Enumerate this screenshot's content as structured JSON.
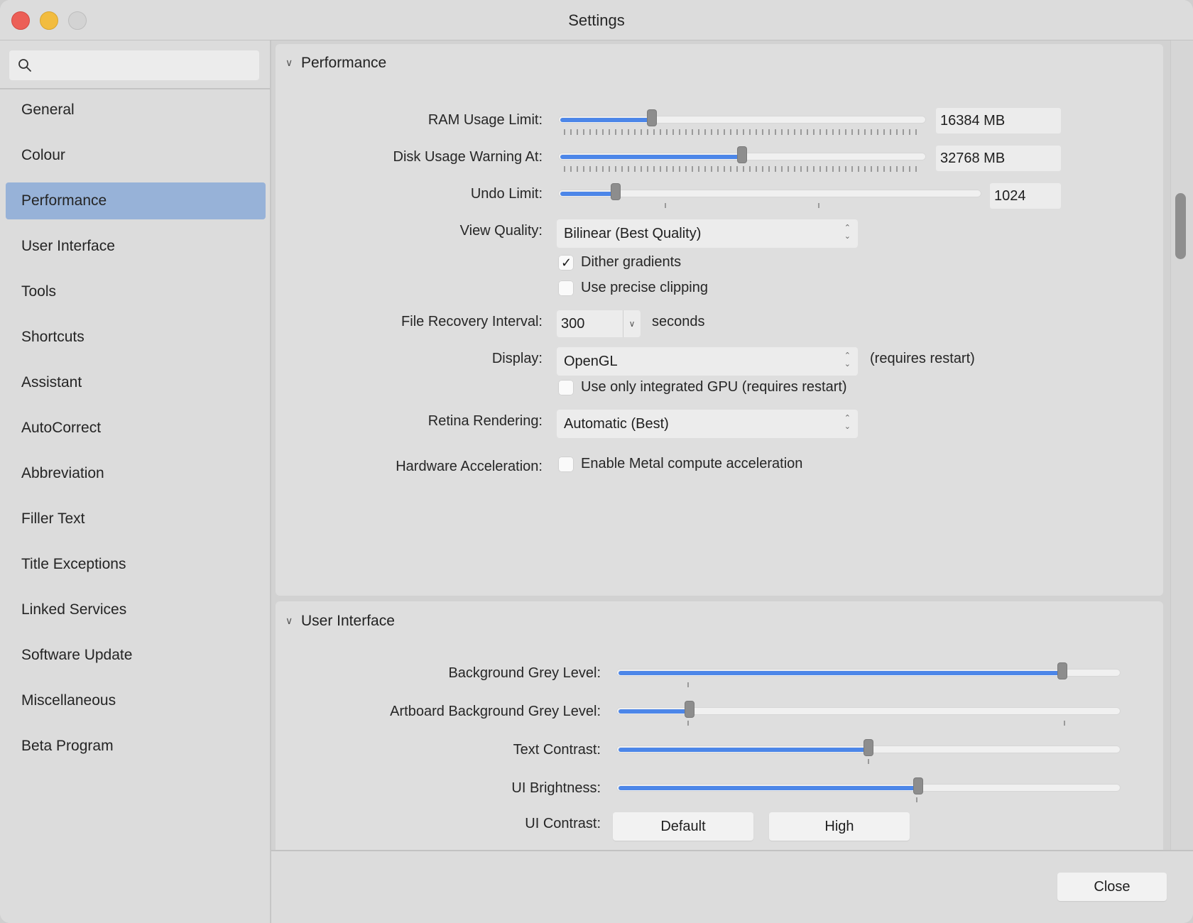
{
  "window": {
    "title": "Settings"
  },
  "search": {
    "placeholder": ""
  },
  "sidebar": {
    "items": [
      {
        "label": "General"
      },
      {
        "label": "Colour"
      },
      {
        "label": "Performance",
        "active": true
      },
      {
        "label": "User Interface"
      },
      {
        "label": "Tools"
      },
      {
        "label": "Shortcuts"
      },
      {
        "label": "Assistant"
      },
      {
        "label": "AutoCorrect"
      },
      {
        "label": "Abbreviation"
      },
      {
        "label": "Filler Text"
      },
      {
        "label": "Title Exceptions"
      },
      {
        "label": "Linked Services"
      },
      {
        "label": "Software Update"
      },
      {
        "label": "Miscellaneous"
      },
      {
        "label": "Beta Program"
      }
    ]
  },
  "performance": {
    "heading": "Performance",
    "ram": {
      "label": "RAM Usage Limit:",
      "value": "16384 MB",
      "level": 0.25
    },
    "disk": {
      "label": "Disk Usage Warning At:",
      "value": "32768 MB",
      "level": 0.5
    },
    "undo": {
      "label": "Undo Limit:",
      "value": "1024",
      "level": 0.13
    },
    "view_quality": {
      "label": "View Quality:",
      "selected": "Bilinear (Best Quality)"
    },
    "dither": {
      "label": "Dither gradients",
      "checked": true
    },
    "precise_clipping": {
      "label": "Use precise clipping",
      "checked": false
    },
    "recovery": {
      "label": "File Recovery Interval:",
      "value": "300",
      "unit": "seconds"
    },
    "display": {
      "label": "Display:",
      "selected": "OpenGL",
      "note": "(requires restart)"
    },
    "integrated_gpu": {
      "label": "Use only integrated GPU (requires restart)",
      "checked": false
    },
    "retina": {
      "label": "Retina Rendering:",
      "selected": "Automatic (Best)"
    },
    "hw_accel": {
      "label": "Hardware Acceleration:",
      "checkbox_label": "Enable Metal compute acceleration",
      "checked": false
    }
  },
  "user_interface": {
    "heading": "User Interface",
    "bg_grey": {
      "label": "Background Grey Level:",
      "level": 0.89
    },
    "artboard_grey": {
      "label": "Artboard Background Grey Level:",
      "level": 0.14
    },
    "text_contrast": {
      "label": "Text Contrast:",
      "level": 0.5
    },
    "ui_brightness": {
      "label": "UI Brightness:",
      "level": 0.6
    },
    "ui_contrast": {
      "label": "UI Contrast:",
      "options": [
        "Default",
        "High"
      ]
    }
  },
  "footer": {
    "close_label": "Close"
  },
  "colors": {
    "accent": "#4c86e8",
    "selection": "#97b2d8"
  }
}
